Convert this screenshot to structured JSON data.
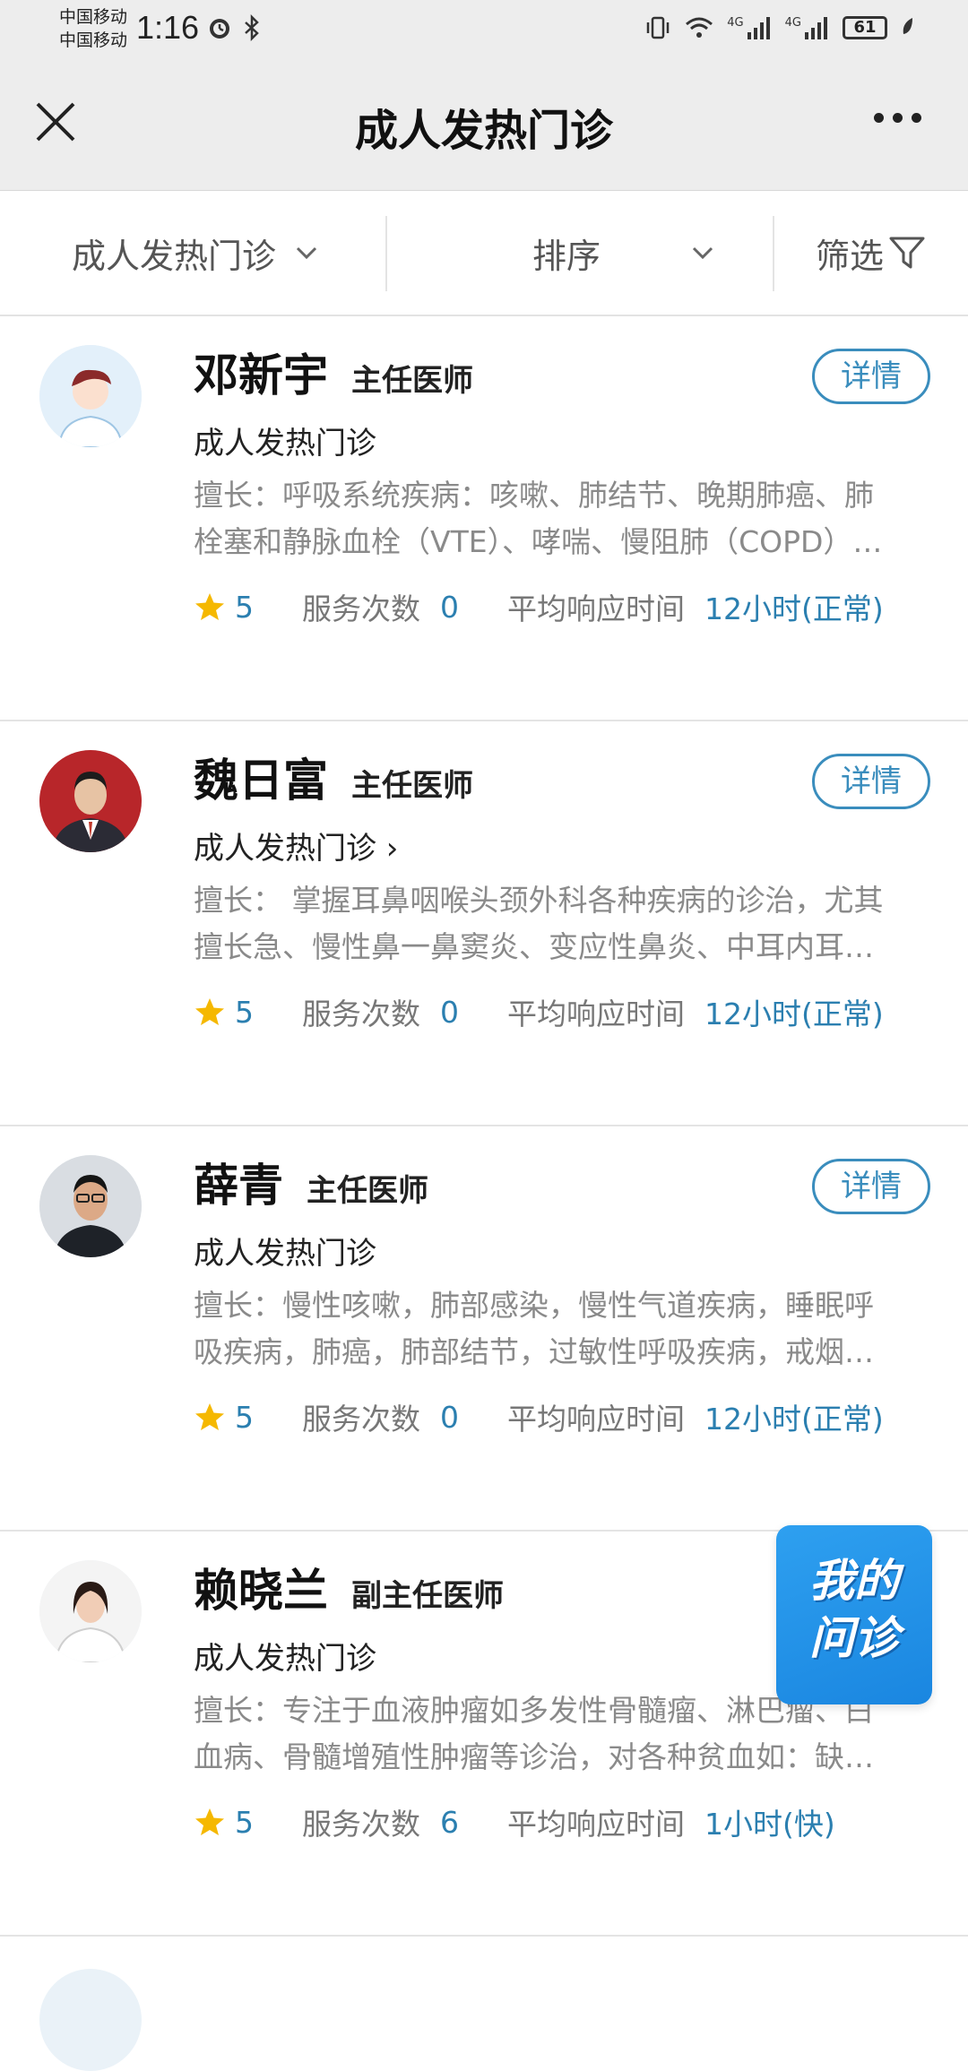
{
  "status": {
    "carrier_top": "中国移动",
    "carrier_bottom": "中国移动",
    "time": "1:16",
    "battery": "61",
    "signal_label_1": "4G",
    "signal_label_2": "4G"
  },
  "nav": {
    "title": "成人发热门诊"
  },
  "filters": {
    "department": "成人发热门诊",
    "sort": "排序",
    "filter": "筛选"
  },
  "doctors": [
    {
      "name": "邓新宇",
      "title": "主任医师",
      "dept": "成人发热门诊",
      "desc_line1": "擅长：呼吸系统疾病：咳嗽、肺结节、晚期肺癌、肺",
      "desc_line2": "栓塞和静脉血栓（VTE）、哮喘、慢阻肺（COPD）…",
      "rating": "5",
      "service_label": "服务次数",
      "service_count": "0",
      "response_label": "平均响应时间",
      "response_time": "12小时(正常)",
      "detail_label": "详情"
    },
    {
      "name": "魏日富",
      "title": "主任医师",
      "dept": "成人发热门诊 ›",
      "desc_line1": "擅长： 掌握耳鼻咽喉头颈外科各种疾病的诊治，尤其",
      "desc_line2": "擅长急、慢性鼻一鼻窦炎、变应性鼻炎、中耳内耳…",
      "rating": "5",
      "service_label": "服务次数",
      "service_count": "0",
      "response_label": "平均响应时间",
      "response_time": "12小时(正常)",
      "detail_label": "详情"
    },
    {
      "name": "薛青",
      "title": "主任医师",
      "dept": "成人发热门诊",
      "desc_line1": "擅长：慢性咳嗽，肺部感染，慢性气道疾病，睡眠呼",
      "desc_line2": "吸疾病，肺癌，肺部结节，过敏性呼吸疾病，戒烟…",
      "rating": "5",
      "service_label": "服务次数",
      "service_count": "0",
      "response_label": "平均响应时间",
      "response_time": "12小时(正常)",
      "detail_label": "详情"
    },
    {
      "name": "赖晓兰",
      "title": "副主任医师",
      "dept": "成人发热门诊",
      "desc_line1": "擅长：专注于血液肿瘤如多发性骨髓瘤、淋巴瘤、白",
      "desc_line2": "血病、骨髓增殖性肿瘤等诊治，对各种贫血如：缺…",
      "rating": "5",
      "service_label": "服务次数",
      "service_count": "6",
      "response_label": "平均响应时间",
      "response_time": "1小时(快)"
    }
  ],
  "floating": {
    "line1": "我的",
    "line2": "问诊"
  }
}
